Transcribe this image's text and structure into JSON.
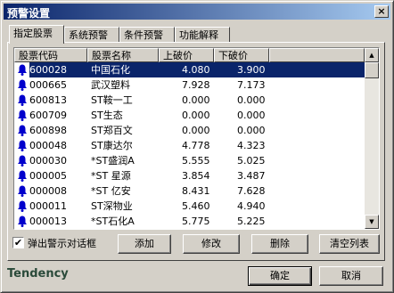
{
  "window": {
    "title": "预警设置",
    "close_glyph": "×"
  },
  "tabs": [
    {
      "label": "指定股票"
    },
    {
      "label": "系统预警"
    },
    {
      "label": "条件预警"
    },
    {
      "label": "功能解释"
    }
  ],
  "table": {
    "columns": [
      "股票代码",
      "股票名称",
      "上破价",
      "下破价"
    ],
    "rows": [
      {
        "code": "600028",
        "name": "中国石化",
        "up": "4.080",
        "down": "3.900",
        "selected": true
      },
      {
        "code": "000665",
        "name": "武汉塑料",
        "up": "7.928",
        "down": "7.173"
      },
      {
        "code": "600813",
        "name": "ST鞍一工",
        "up": "0.000",
        "down": "0.000"
      },
      {
        "code": "600709",
        "name": "ST生态",
        "up": "0.000",
        "down": "0.000"
      },
      {
        "code": "600898",
        "name": "ST郑百文",
        "up": "0.000",
        "down": "0.000"
      },
      {
        "code": "000048",
        "name": "ST康达尔",
        "up": "4.778",
        "down": "4.323"
      },
      {
        "code": "000030",
        "name": "*ST盛润A",
        "up": "5.555",
        "down": "5.025"
      },
      {
        "code": "000005",
        "name": "*ST 星源",
        "up": "3.854",
        "down": "3.487"
      },
      {
        "code": "000008",
        "name": "*ST 亿安",
        "up": "8.431",
        "down": "7.628"
      },
      {
        "code": "000011",
        "name": "ST深物业",
        "up": "5.460",
        "down": "4.940"
      },
      {
        "code": "000013",
        "name": "*ST石化A",
        "up": "5.775",
        "down": "5.225"
      }
    ],
    "row_icon": "bell-icon"
  },
  "popup_checkbox": {
    "label": "弹出警示对话框",
    "checked": true,
    "check_glyph": "✔"
  },
  "buttons": {
    "add": "添加",
    "edit": "修改",
    "delete": "删除",
    "clear": "清空列表",
    "ok": "确定",
    "cancel": "取消"
  },
  "brand": "Tendency",
  "scrollbar": {
    "up_glyph": "▲",
    "down_glyph": "▼"
  },
  "colors": {
    "selection": "#0a246a",
    "bell": "#0000cc",
    "brand": "#2a4a3a"
  }
}
